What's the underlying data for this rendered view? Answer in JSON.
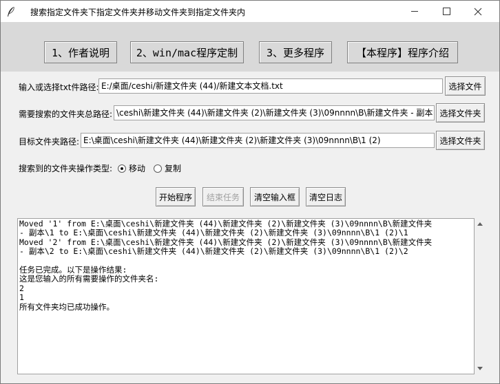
{
  "window": {
    "title": "搜索指定文件夹下指定文件夹并移动文件夹到指定文件夹内"
  },
  "topbar": {
    "buttons": [
      "1、作者说明",
      "2、win/mac程序定制",
      "3、更多程序",
      "【本程序】程序介绍"
    ]
  },
  "form": {
    "txt_label": "输入或选择txt件路径:",
    "txt_value": "E:/桌面/ceshi/新建文件夹 (44)/新建文本文档.txt",
    "txt_button": "选择文件",
    "search_label": "需要搜索的文件夹总路径:",
    "search_value": "\\ceshi\\新建文件夹 (44)\\新建文件夹 (2)\\新建文件夹 (3)\\09nnnn\\B\\新建文件夹 - 副本",
    "search_button": "选择文件夹",
    "target_label": "目标文件夹路径:",
    "target_value": "E:\\桌面\\ceshi\\新建文件夹 (44)\\新建文件夹 (2)\\新建文件夹 (3)\\09nnnn\\B\\1 (2)",
    "target_button": "选择文件夹",
    "op_label": "搜索到的文件夹操作类型:",
    "op_move": "移动",
    "op_copy": "复制",
    "op_selected": "移动"
  },
  "actions": {
    "start": "开始程序",
    "stop": "结束任务",
    "clear_input": "清空输入框",
    "clear_log": "清空日志"
  },
  "log": {
    "lines": [
      "Moved '1' from E:\\桌面\\ceshi\\新建文件夹 (44)\\新建文件夹 (2)\\新建文件夹 (3)\\09nnnn\\B\\新建文件夹",
      "- 副本\\1 to E:\\桌面\\ceshi\\新建文件夹 (44)\\新建文件夹 (2)\\新建文件夹 (3)\\09nnnn\\B\\1 (2)\\1",
      "Moved '2' from E:\\桌面\\ceshi\\新建文件夹 (44)\\新建文件夹 (2)\\新建文件夹 (3)\\09nnnn\\B\\新建文件夹",
      "- 副本\\2 to E:\\桌面\\ceshi\\新建文件夹 (44)\\新建文件夹 (2)\\新建文件夹 (3)\\09nnnn\\B\\1 (2)\\2",
      "",
      "任务已完成。以下是操作结果:",
      "这是您输入的所有需要操作的文件夹名:",
      "2",
      "1",
      "所有文件夹均已成功操作。"
    ]
  },
  "icons": {
    "app": "feather-icon",
    "minimize": "minimize-icon",
    "maximize": "maximize-icon",
    "close": "close-icon"
  }
}
